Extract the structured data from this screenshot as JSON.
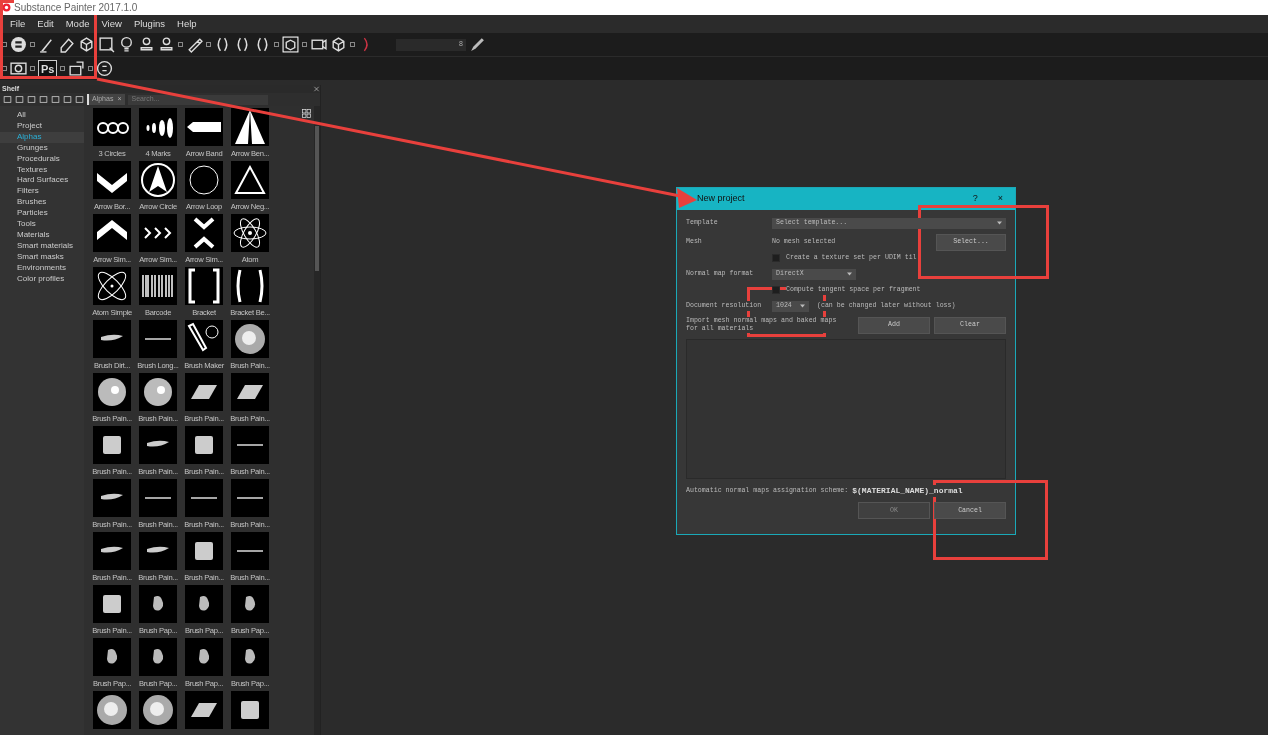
{
  "window": {
    "title": "Substance Painter 2017.1.0"
  },
  "menu": [
    "File",
    "Edit",
    "Mode",
    "View",
    "Plugins",
    "Help"
  ],
  "toolbar": {
    "ps_label": "Ps",
    "size_reading": "8"
  },
  "shelf": {
    "title": "Shelf",
    "filter_tag": "Alphas",
    "filter_close": "×",
    "search_placeholder": "Search...",
    "categories": [
      {
        "label": "All",
        "selected": false
      },
      {
        "label": "Project",
        "selected": false
      },
      {
        "label": "Alphas",
        "selected": true
      },
      {
        "label": "Grunges",
        "selected": false
      },
      {
        "label": "Procedurals",
        "selected": false
      },
      {
        "label": "Textures",
        "selected": false
      },
      {
        "label": "Hard Surfaces",
        "selected": false
      },
      {
        "label": "Filters",
        "selected": false
      },
      {
        "label": "Brushes",
        "selected": false
      },
      {
        "label": "Particles",
        "selected": false
      },
      {
        "label": "Tools",
        "selected": false
      },
      {
        "label": "Materials",
        "selected": false
      },
      {
        "label": "Smart materials",
        "selected": false
      },
      {
        "label": "Smart masks",
        "selected": false
      },
      {
        "label": "Environments",
        "selected": false
      },
      {
        "label": "Color profiles",
        "selected": false
      }
    ],
    "items": [
      {
        "label": "3 Circles",
        "kind": "circles"
      },
      {
        "label": "4 Marks",
        "kind": "marks"
      },
      {
        "label": "Arrow Band",
        "kind": "band"
      },
      {
        "label": "Arrow Ben...",
        "kind": "arrow"
      },
      {
        "label": "Arrow Bor...",
        "kind": "chevron-down"
      },
      {
        "label": "Arrow Circle",
        "kind": "arrow-circle"
      },
      {
        "label": "Arrow Loop",
        "kind": "loop"
      },
      {
        "label": "Arrow Neg...",
        "kind": "triangle"
      },
      {
        "label": "Arrow Sim...",
        "kind": "chevron-up"
      },
      {
        "label": "Arrow Sim...",
        "kind": "chevrons"
      },
      {
        "label": "Arrow Sim...",
        "kind": "hourglass"
      },
      {
        "label": "Atom",
        "kind": "atom"
      },
      {
        "label": "Atom Simple",
        "kind": "orbits"
      },
      {
        "label": "Barcode",
        "kind": "barcode"
      },
      {
        "label": "Bracket",
        "kind": "bracket"
      },
      {
        "label": "Bracket Be...",
        "kind": "paren"
      },
      {
        "label": "Brush Dirt...",
        "kind": "smear"
      },
      {
        "label": "Brush Long...",
        "kind": "line"
      },
      {
        "label": "Brush Maker",
        "kind": "brush-gear"
      },
      {
        "label": "Brush Pain...",
        "kind": "swirl"
      },
      {
        "label": "Brush Pain...",
        "kind": "sphere"
      },
      {
        "label": "Brush Pain...",
        "kind": "sphere"
      },
      {
        "label": "Brush Pain...",
        "kind": "slab"
      },
      {
        "label": "Brush Pain...",
        "kind": "slab"
      },
      {
        "label": "Brush Pain...",
        "kind": "patch"
      },
      {
        "label": "Brush Pain...",
        "kind": "smear"
      },
      {
        "label": "Brush Pain...",
        "kind": "patch"
      },
      {
        "label": "Brush Pain...",
        "kind": "line"
      },
      {
        "label": "Brush Pain...",
        "kind": "smear"
      },
      {
        "label": "Brush Pain...",
        "kind": "line"
      },
      {
        "label": "Brush Pain...",
        "kind": "line"
      },
      {
        "label": "Brush Pain...",
        "kind": "line"
      },
      {
        "label": "Brush Pain...",
        "kind": "smear"
      },
      {
        "label": "Brush Pain...",
        "kind": "smear"
      },
      {
        "label": "Brush Pain...",
        "kind": "patch"
      },
      {
        "label": "Brush Pain...",
        "kind": "line"
      },
      {
        "label": "Brush Pain...",
        "kind": "patch"
      },
      {
        "label": "Brush Pap...",
        "kind": "blot"
      },
      {
        "label": "Brush Pap...",
        "kind": "blot"
      },
      {
        "label": "Brush Pap...",
        "kind": "blot"
      },
      {
        "label": "Brush Pap...",
        "kind": "blot"
      },
      {
        "label": "Brush Pap...",
        "kind": "blot"
      },
      {
        "label": "Brush Pap...",
        "kind": "blot"
      },
      {
        "label": "Brush Pap...",
        "kind": "blot"
      },
      {
        "kind": "swirl"
      },
      {
        "kind": "swirl"
      },
      {
        "kind": "slab"
      },
      {
        "kind": "patch"
      }
    ]
  },
  "dialog": {
    "title": "New project",
    "help": "?",
    "close": "×",
    "template_label": "Template",
    "template_value": "Select template...",
    "mesh_label": "Mesh",
    "mesh_value": "No mesh selected",
    "select_button": "Select...",
    "udim_checkbox": {
      "label": "Create a texture set per UDIM til",
      "checked": false
    },
    "normal_label": "Normal map format",
    "normal_value": "DirectX",
    "tangent_checkbox": {
      "label": "Compute tangent space per fragment",
      "checked": false
    },
    "resolution_label": "Document resolution",
    "resolution_value": "1024",
    "resolution_note": "(can be changed later without loss)",
    "import_label": "Import mesh normal maps and baked maps for all materials",
    "add_button": "Add",
    "clear_button": "Clear",
    "scheme_label": "Automatic normal maps assignation scheme:",
    "scheme_value": "$(MATERIAL_NAME)_normal",
    "ok_button": {
      "label": "OK",
      "disabled": true
    },
    "cancel_button": "Cancel"
  },
  "annotations": [
    {
      "kind": "frame"
    },
    {
      "kind": "frame"
    },
    {
      "kind": "frame"
    },
    {
      "kind": "frame"
    },
    {
      "kind": "arrow"
    }
  ]
}
